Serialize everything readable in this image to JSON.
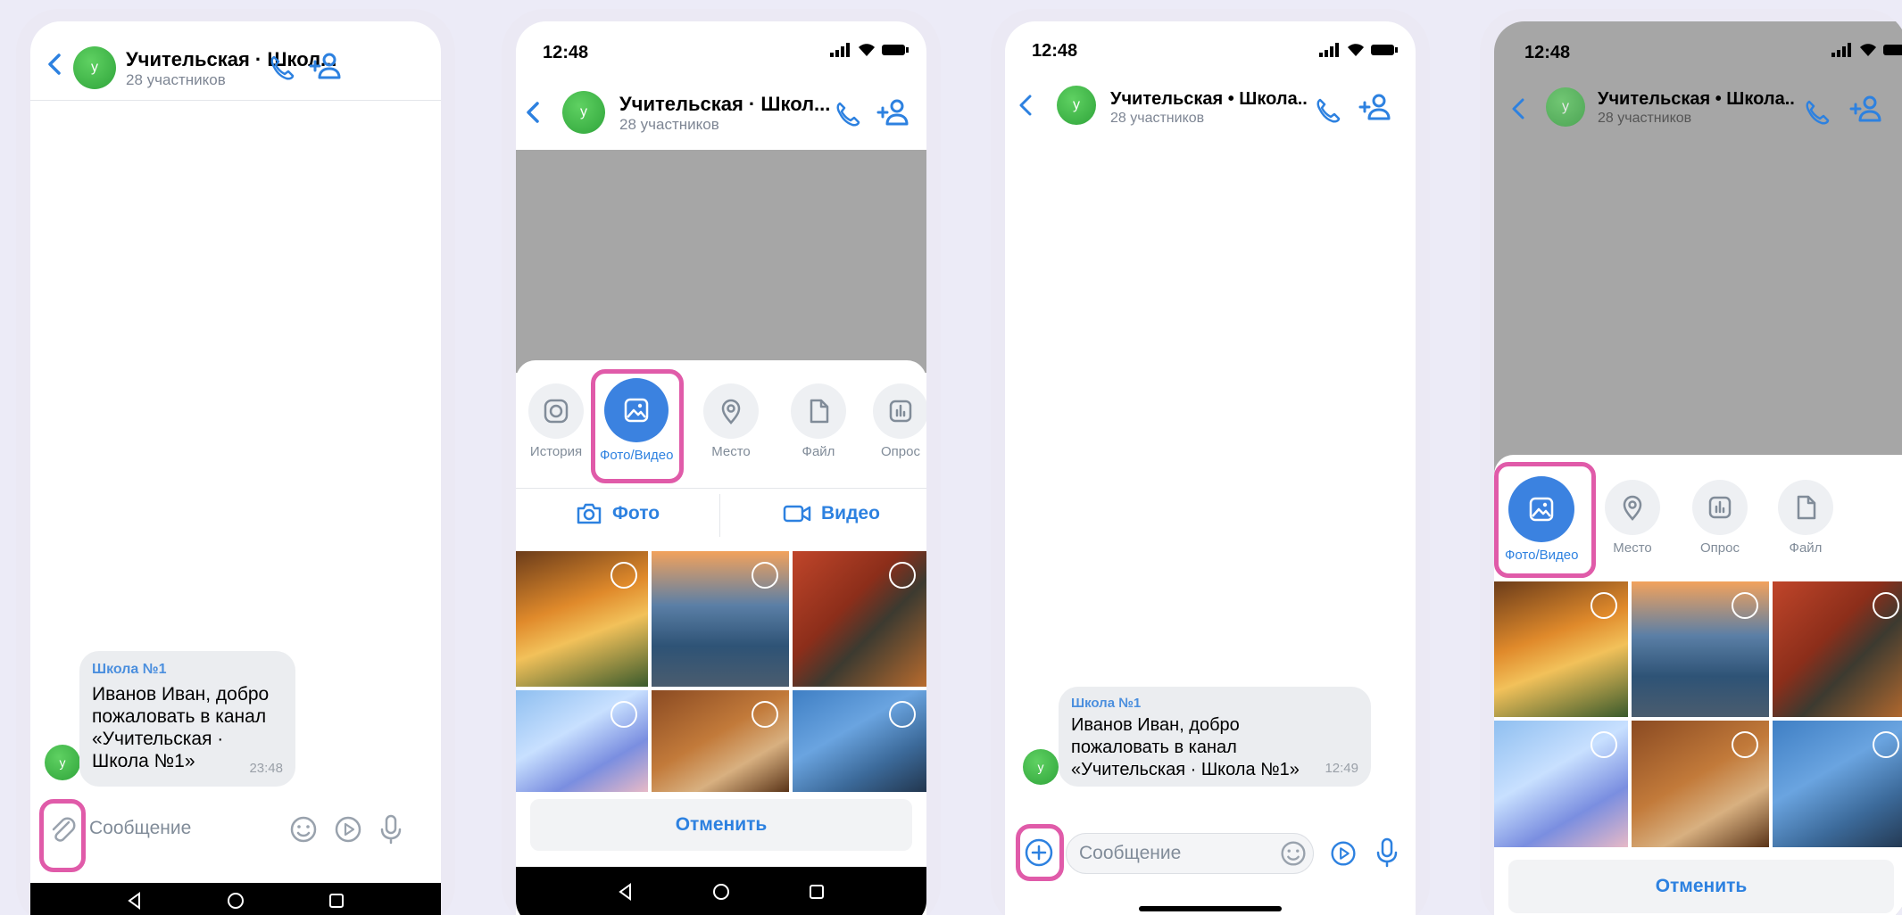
{
  "colors": {
    "accent": "#2d81e0",
    "highlight": "#e05ba9",
    "avatar": "#34b13d",
    "background": "#ecebf7"
  },
  "chat": {
    "title": "Учительская · Школ...",
    "title_ios": "Учительская • Школа..",
    "subtitle": "28 участников",
    "avatar_letter": "у"
  },
  "status_bar": {
    "time": "12:48"
  },
  "message": {
    "sender": "Школа №1",
    "text_android": "Иванов Иван, добро пожаловать в канал «Учительская · Школа №1»",
    "text_ios": "Иванов Иван, добро пожаловать в канал «Учительская · Школа №1»",
    "time_android": "23:48",
    "time_ios": "12:49"
  },
  "input": {
    "placeholder": "Сообщение"
  },
  "attachments_android": [
    {
      "label": "История",
      "icon": "instagram-icon"
    },
    {
      "label": "Фото/Видео",
      "icon": "gallery-icon"
    },
    {
      "label": "Место",
      "icon": "location-icon"
    },
    {
      "label": "Файл",
      "icon": "file-icon"
    },
    {
      "label": "Опрос",
      "icon": "poll-icon"
    }
  ],
  "attachments_ios": [
    {
      "label": "Фото/Видео",
      "icon": "gallery-icon"
    },
    {
      "label": "Место",
      "icon": "location-icon"
    },
    {
      "label": "Опрос",
      "icon": "poll-icon"
    },
    {
      "label": "Файл",
      "icon": "file-icon"
    }
  ],
  "media_tabs": {
    "photo": "Фото",
    "video": "Видео"
  },
  "cancel_label": "Отменить",
  "gallery": [
    "puss-in-boots",
    "lensball-lighthouse",
    "autumn-coffee-cup",
    "anime-girl",
    "cat-newspaper",
    "frog-pilot"
  ]
}
